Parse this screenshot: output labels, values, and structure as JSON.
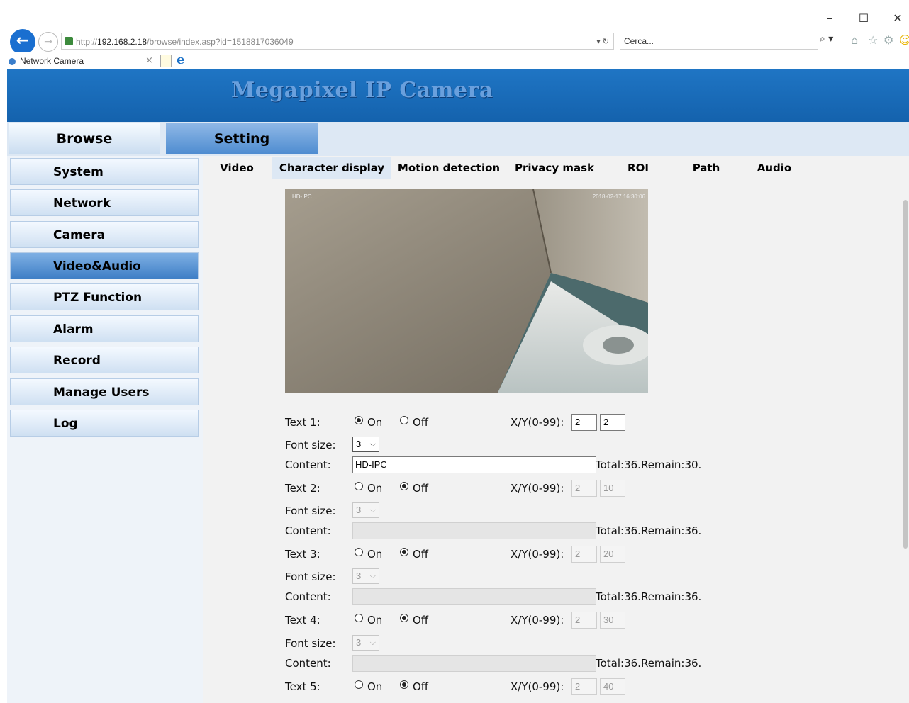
{
  "window": {
    "minimize": "–",
    "maximize": "☐",
    "close": "✕"
  },
  "browser": {
    "back": "←",
    "forward": "→",
    "url_prefix": "http://",
    "url_host": "192.168.2.18",
    "url_path": "/browse/index.asp?id=1518817036049",
    "url_dropdown": "▾ ↻",
    "search_placeholder": "Cerca...",
    "search_icon": "⌕ ▾",
    "tab_title": "Network Camera",
    "tab_close": "×",
    "ie_logo": "e",
    "icons": [
      "home-icon",
      "star-icon",
      "gear-icon",
      "smiley-icon"
    ]
  },
  "page": {
    "banner_title": "Megapixel IP Camera",
    "main_tabs": [
      {
        "label": "Browse",
        "active": false
      },
      {
        "label": "Setting",
        "active": true
      }
    ],
    "sidebar": [
      {
        "label": "System"
      },
      {
        "label": "Network"
      },
      {
        "label": "Camera"
      },
      {
        "label": "Video&Audio",
        "active": true
      },
      {
        "label": "PTZ Function"
      },
      {
        "label": "Alarm"
      },
      {
        "label": "Record"
      },
      {
        "label": "Manage Users"
      },
      {
        "label": "Log"
      }
    ],
    "sub_tabs": [
      {
        "label": "Video"
      },
      {
        "label": "Character display",
        "active": true
      },
      {
        "label": "Motion detection"
      },
      {
        "label": "Privacy mask"
      },
      {
        "label": "ROI"
      },
      {
        "label": "Path"
      },
      {
        "label": "Audio"
      }
    ],
    "preview": {
      "overlay_left": "HD-IPC",
      "overlay_right": "2018-02-17  16:30:06"
    },
    "labels": {
      "font_size": "Font size:",
      "content": "Content:",
      "on": "On",
      "off": "Off",
      "xy": "X/Y(0-99):"
    },
    "texts": [
      {
        "label": "Text 1:",
        "state": "on",
        "x": "2",
        "y": "2",
        "font_size": "3",
        "content": "HD-IPC",
        "counter": "Total:36.Remain:30.",
        "enabled": true
      },
      {
        "label": "Text 2:",
        "state": "off",
        "x": "2",
        "y": "10",
        "font_size": "3",
        "content": "",
        "counter": "Total:36.Remain:36.",
        "enabled": false
      },
      {
        "label": "Text 3:",
        "state": "off",
        "x": "2",
        "y": "20",
        "font_size": "3",
        "content": "",
        "counter": "Total:36.Remain:36.",
        "enabled": false
      },
      {
        "label": "Text 4:",
        "state": "off",
        "x": "2",
        "y": "30",
        "font_size": "3",
        "content": "",
        "counter": "Total:36.Remain:36.",
        "enabled": false
      },
      {
        "label": "Text 5:",
        "state": "off",
        "x": "2",
        "y": "40",
        "enabled": false
      }
    ]
  }
}
